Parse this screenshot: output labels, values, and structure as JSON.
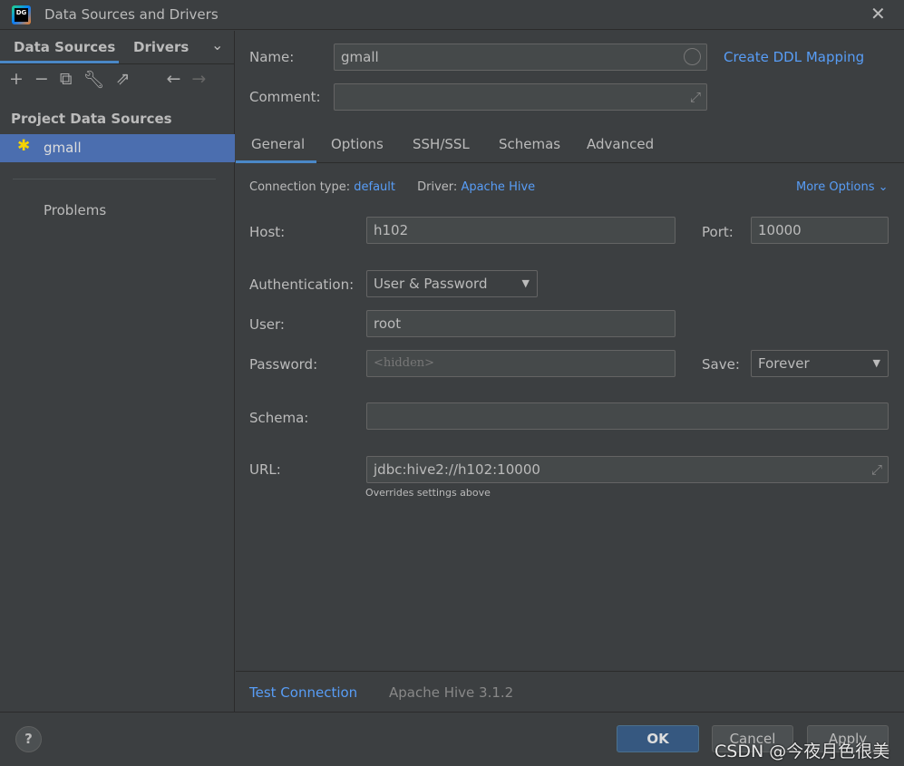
{
  "window": {
    "title": "Data Sources and Drivers",
    "close_icon": "close-icon"
  },
  "sidebar": {
    "tabs": [
      "Data Sources",
      "Drivers"
    ],
    "section": "Project Data Sources",
    "items": [
      {
        "label": "gmall",
        "icon": "hive-bee-icon",
        "selected": true
      }
    ],
    "problems": "Problems"
  },
  "form": {
    "name_label": "Name:",
    "name_value": "gmall",
    "comment_label": "Comment:",
    "comment_value": "",
    "ddl_link": "Create DDL Mapping",
    "tabs": [
      "General",
      "Options",
      "SSH/SSL",
      "Schemas",
      "Advanced"
    ],
    "active_tab": "General",
    "conn_type_label": "Connection type:",
    "conn_type": "default",
    "driver_label": "Driver:",
    "driver": "Apache Hive",
    "more_options": "More Options",
    "host_label": "Host:",
    "host": "h102",
    "port_label": "Port:",
    "port": "10000",
    "auth_label": "Authentication:",
    "auth": "User & Password",
    "user_label": "User:",
    "user": "root",
    "password_label": "Password:",
    "password_placeholder": "<hidden>",
    "save_label": "Save:",
    "save": "Forever",
    "schema_label": "Schema:",
    "schema": "",
    "url_label": "URL:",
    "url": "jdbc:hive2://h102:10000",
    "url_hint": "Overrides settings above"
  },
  "footer": {
    "test_connection": "Test Connection",
    "driver_version": "Apache Hive 3.1.2",
    "help": "?",
    "ok": "OK",
    "cancel": "Cancel",
    "apply": "Apply"
  },
  "watermark": "CSDN @今夜月色很美",
  "colors": {
    "accent": "#589df6",
    "selection": "#4b6eaf",
    "ok_button": "#365880"
  }
}
